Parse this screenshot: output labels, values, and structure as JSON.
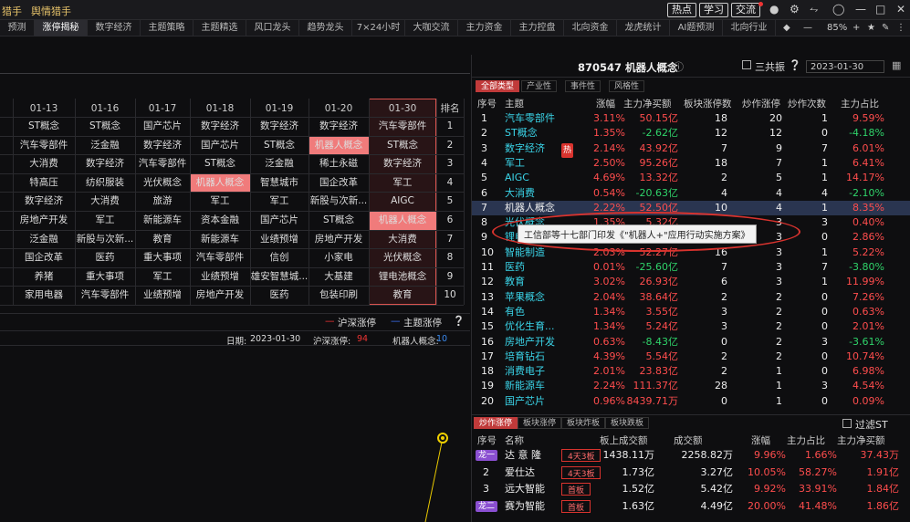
{
  "topbar": {
    "left1": "猎手",
    "left2": "舆情猎手",
    "btn_hot": "热点",
    "btn_study": "学习",
    "btn_exchange": "交流"
  },
  "tabs": [
    "预测",
    "涨停揭秘",
    "数字经济",
    "主题策略",
    "主题精选",
    "风口龙头",
    "趋势龙头",
    "7×24小时",
    "大咖交流",
    "主力资金",
    "主力控盘",
    "北向资金",
    "龙虎统计",
    "AI题预测",
    "北向行业"
  ],
  "tab_tail": {
    "zoom": "85%"
  },
  "left": {
    "dates": [
      "01-13",
      "01-16",
      "01-17",
      "01-18",
      "01-19",
      "01-20",
      "01-30"
    ],
    "rank_header": "排名",
    "partial_col": [
      "",
      "",
      "",
      "",
      "",
      "",
      "",
      "",
      "",
      ""
    ],
    "rows": [
      [
        "",
        "ST概念",
        "ST概念",
        "国产芯片",
        "数字经济",
        "数字经济",
        "数字经济",
        "汽车零部件"
      ],
      [
        "",
        "汽车零部件",
        "泛金融",
        "数字经济",
        "国产芯片",
        "ST概念",
        "机器人概念",
        "ST概念"
      ],
      [
        "",
        "大消费",
        "数字经济",
        "汽车零部件",
        "ST概念",
        "泛金融",
        "稀土永磁",
        "数字经济"
      ],
      [
        "",
        "特高压",
        "纺织服装",
        "光伏概念",
        "机器人概念",
        "智慧城市",
        "国企改革",
        "军工"
      ],
      [
        "",
        "数字经济",
        "大消费",
        "旅游",
        "军工",
        "军工",
        "新股与次新...",
        "AIGC"
      ],
      [
        "",
        "房地产开发",
        "军工",
        "新能源车",
        "资本金融",
        "国产芯片",
        "ST概念",
        "机器人概念"
      ],
      [
        "",
        "泛金融",
        "新股与次新...",
        "教育",
        "新能源车",
        "业绩预增",
        "房地产开发",
        "大消费"
      ],
      [
        "",
        "国企改革",
        "医药",
        "重大事项",
        "汽车零部件",
        "信创",
        "小家电",
        "光伏概念"
      ],
      [
        "",
        "养猪",
        "重大事项",
        "军工",
        "业绩预增",
        "雄安智慧城...",
        "大基建",
        "锂电池概念"
      ],
      [
        "",
        "家用电器",
        "汽车零部件",
        "业绩预增",
        "房地产开发",
        "医药",
        "包装印刷",
        "教育"
      ]
    ],
    "ranks": [
      "1",
      "2",
      "3",
      "4",
      "5",
      "6",
      "7",
      "8",
      "9",
      "10"
    ],
    "legend_red": "沪深涨停",
    "legend_blue": "主题涨停",
    "footer_date_label": "日期:",
    "footer_date": "2023-01-30",
    "footer_hs_label": "沪深涨停:",
    "footer_hs": "94",
    "footer_robot_label": "机器人概念:",
    "footer_robot": "10"
  },
  "right": {
    "title": "870547 机器人概念",
    "sangong": "三共振",
    "date": "2023-01-30",
    "subtabs": [
      "全部类型",
      "产业性",
      "事件性",
      "风格性"
    ],
    "headers": [
      "序号",
      "主题",
      "涨幅",
      "主力净买额",
      "板块涨停数",
      "炒作涨停",
      "炒作次数",
      "主力占比"
    ],
    "rows": [
      [
        "1",
        "汽车零部件",
        "3.11%",
        "50.15亿",
        "18",
        "20",
        "1",
        "9.59%"
      ],
      [
        "2",
        "ST概念",
        "1.35%",
        "-2.62亿",
        "12",
        "12",
        "0",
        "-4.18%"
      ],
      [
        "3",
        "数字经济",
        "2.14%",
        "43.92亿",
        "7",
        "9",
        "7",
        "6.01%"
      ],
      [
        "4",
        "军工",
        "2.50%",
        "95.26亿",
        "18",
        "7",
        "1",
        "6.41%"
      ],
      [
        "5",
        "AIGC",
        "4.69%",
        "13.32亿",
        "2",
        "5",
        "1",
        "14.17%"
      ],
      [
        "6",
        "大消费",
        "0.54%",
        "-20.63亿",
        "4",
        "4",
        "4",
        "-2.10%"
      ],
      [
        "7",
        "机器人概念",
        "2.22%",
        "52.50亿",
        "10",
        "4",
        "1",
        "8.35%"
      ],
      [
        "8",
        "光伏概念",
        "1.35%",
        "5.32亿",
        "",
        "3",
        "3",
        "0.40%"
      ],
      [
        "9",
        "锂电池概念",
        "",
        "",
        "",
        "3",
        "0",
        "2.86%"
      ],
      [
        "10",
        "智能制造",
        "2.03%",
        "52.27亿",
        "16",
        "3",
        "1",
        "5.22%"
      ],
      [
        "11",
        "医药",
        "0.01%",
        "-25.60亿",
        "7",
        "3",
        "7",
        "-3.80%"
      ],
      [
        "12",
        "教育",
        "3.02%",
        "26.93亿",
        "6",
        "3",
        "1",
        "11.99%"
      ],
      [
        "13",
        "苹果概念",
        "2.04%",
        "38.64亿",
        "2",
        "2",
        "0",
        "7.26%"
      ],
      [
        "14",
        "有色",
        "1.34%",
        "3.55亿",
        "3",
        "2",
        "0",
        "0.63%"
      ],
      [
        "15",
        "优化生育...",
        "1.34%",
        "5.24亿",
        "3",
        "2",
        "0",
        "2.01%"
      ],
      [
        "16",
        "房地产开发",
        "0.63%",
        "-8.43亿",
        "0",
        "2",
        "3",
        "-3.61%"
      ],
      [
        "17",
        "培育钻石",
        "4.39%",
        "5.54亿",
        "2",
        "2",
        "0",
        "10.74%"
      ],
      [
        "18",
        "消费电子",
        "2.01%",
        "23.83亿",
        "2",
        "1",
        "0",
        "6.98%"
      ],
      [
        "19",
        "新能源车",
        "2.24%",
        "111.37亿",
        "28",
        "1",
        "3",
        "4.54%"
      ],
      [
        "20",
        "国产芯片",
        "0.96%",
        "8439.71万",
        "0",
        "1",
        "0",
        "0.09%"
      ]
    ],
    "hot_tag": "热",
    "tooltip": "工信部等十七部门印发《\"机器人+\"应用行动实施方案》",
    "bottom_tabs": [
      "炒作涨停",
      "板块涨停",
      "板块炸板",
      "板块跌板"
    ],
    "filter_st": "过滤ST",
    "bottom_headers": [
      "序号",
      "名称",
      "板上成交额",
      "成交额",
      "涨幅",
      "主力占比",
      "主力净买额"
    ],
    "bottom_rows": [
      {
        "no": "龙一",
        "name": "达 意 隆",
        "tag": "4天3板",
        "a": "1438.11万",
        "b": "2258.82万",
        "c": "9.96%",
        "d": "1.66%",
        "e": "37.43万"
      },
      {
        "no": "2",
        "name": "爱仕达",
        "tag": "4天3板",
        "a": "1.73亿",
        "b": "3.27亿",
        "c": "10.05%",
        "d": "58.27%",
        "e": "1.91亿"
      },
      {
        "no": "3",
        "name": "远大智能",
        "tag": "首板",
        "a": "1.52亿",
        "b": "5.42亿",
        "c": "9.92%",
        "d": "33.91%",
        "e": "1.84亿"
      },
      {
        "no": "龙二",
        "name": "赛为智能",
        "tag": "首板",
        "a": "1.63亿",
        "b": "4.49亿",
        "c": "20.00%",
        "d": "41.48%",
        "e": "1.86亿"
      }
    ]
  }
}
